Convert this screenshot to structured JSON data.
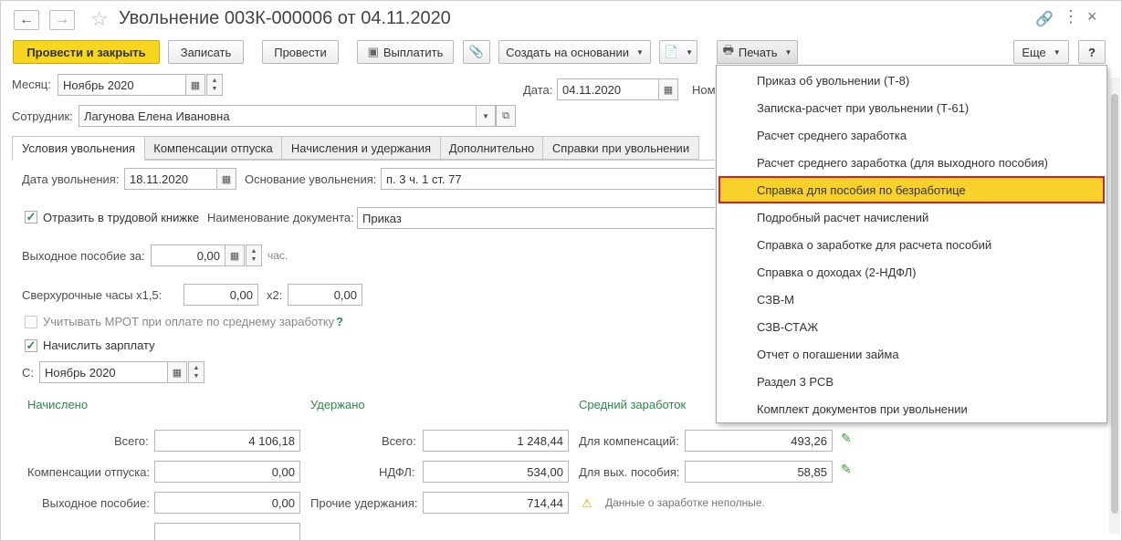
{
  "title": "Увольнение 003К-000006 от 04.11.2020",
  "toolbar": {
    "post_close": "Провести и закрыть",
    "save": "Записать",
    "post": "Провести",
    "pay": "Выплатить",
    "create_based": "Создать на основании",
    "print": "Печать",
    "more": "Еще",
    "help": "?"
  },
  "header": {
    "month_label": "Месяц:",
    "month_value": "Ноябрь 2020",
    "date_label": "Дата:",
    "date_value": "04.11.2020",
    "number_label_partial": "Ном",
    "employee_label": "Сотрудник:",
    "employee_value": "Лагунова Елена Ивановна"
  },
  "tabs": [
    "Условия увольнения",
    "Компенсации отпуска",
    "Начисления и удержания",
    "Дополнительно",
    "Справки при увольнении"
  ],
  "conditions": {
    "dismissal_date_label": "Дата увольнения:",
    "dismissal_date_value": "18.11.2020",
    "basis_label": "Основание увольнения:",
    "basis_value": "п. 3 ч. 1 ст. 77",
    "workbook_label": "Отразить в трудовой книжке",
    "docname_label": "Наименование документа:",
    "docname_value": "Приказ",
    "severance_label": "Выходное пособие за:",
    "severance_value": "0,00",
    "severance_unit": "час.",
    "overtime_label": "Сверхурочные часы x1,5:",
    "overtime_value1": "0,00",
    "overtime_x2_label": "x2:",
    "overtime_value2": "0,00",
    "mrot_label": "Учитывать МРОТ при оплате по среднему заработку",
    "mrot_help": "?",
    "accrue_label": "Начислить зарплату",
    "from_label": "С:",
    "from_value": "Ноябрь 2020"
  },
  "accrued": {
    "heading": "Начислено",
    "total_label": "Всего:",
    "total_value": "4 106,18",
    "comp_label": "Компенсации отпуска:",
    "comp_value": "0,00",
    "severance_label": "Выходное пособие:",
    "severance_value": "0,00"
  },
  "withheld": {
    "heading": "Удержано",
    "total_label": "Всего:",
    "total_value": "1 248,44",
    "ndfl_label": "НДФЛ:",
    "ndfl_value": "534,00",
    "other_label": "Прочие удержания:",
    "other_value": "714,44"
  },
  "average": {
    "heading": "Средний заработок",
    "comp_label": "Для компенсаций:",
    "comp_value": "493,26",
    "sev_label": "Для вых. пособия:",
    "sev_value": "58,85",
    "warning": "Данные о заработке неполные."
  },
  "print_menu": [
    "Приказ об увольнении (Т-8)",
    "Записка-расчет при увольнении (Т-61)",
    "Расчет среднего заработка",
    "Расчет среднего заработка (для выходного пособия)",
    "Справка для пособия по безработице",
    "Подробный расчет начислений",
    "Справка о заработке для расчета пособий",
    "Справка о доходах (2-НДФЛ)",
    "СЗВ-М",
    "СЗВ-СТАЖ",
    "Отчет о погашении займа",
    "Раздел 3 РСВ",
    "Комплект документов при увольнении"
  ],
  "selected_menu_item": "Справка для пособия по безработице",
  "colors": {
    "primary_button": "#f6d61e",
    "section_heading": "#2a8b46",
    "menu_highlight": "#f8d22a",
    "highlight_border": "#d6201f"
  }
}
